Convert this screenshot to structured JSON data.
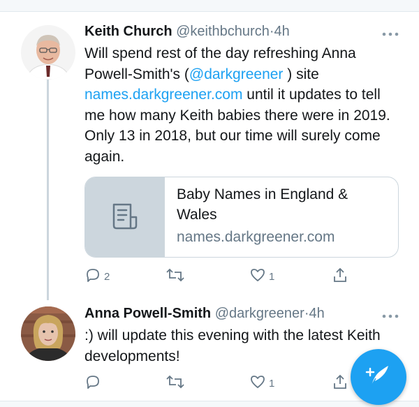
{
  "colors": {
    "accent": "#1da1f2",
    "muted": "#657786",
    "border": "#ccd6dd"
  },
  "tweets": [
    {
      "name": "Keith Church",
      "handle": "@keithbchurch",
      "sep": "·",
      "time": "4h",
      "more_icon": "ellipsis-icon",
      "text": {
        "part1": "Will spend rest of the day refreshing Anna Powell-Smith's (",
        "mention": "@darkgreener",
        "part2": " ) site ",
        "url": "names.darkgreener.com",
        "part3": " until it updates to tell me how many Keith babies there were in 2019. Only 13 in 2018, but our time will surely come again."
      },
      "card": {
        "icon": "article-icon",
        "title": "Baby Names in England & Wales",
        "domain": "names.darkgreener.com"
      },
      "actions": {
        "replies": "2",
        "retweets": "",
        "likes": "1"
      }
    },
    {
      "name": "Anna Powell-Smith",
      "handle": "@darkgreener",
      "sep": "·",
      "time": "4h",
      "more_icon": "ellipsis-icon",
      "text": ":) will update this evening with the latest Keith developments!",
      "actions": {
        "replies": "",
        "retweets": "",
        "likes": "1"
      }
    }
  ],
  "fab": {
    "icon": "compose-tweet-icon"
  }
}
